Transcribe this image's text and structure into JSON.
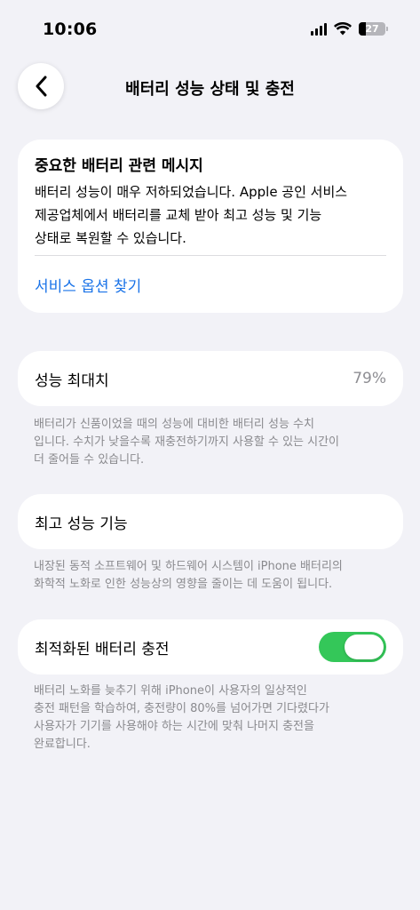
{
  "status_bar": {
    "time": "10:06",
    "battery_level": "27"
  },
  "nav": {
    "title": "배터리 성능 상태 및 충전"
  },
  "alert": {
    "title": "중요한 배터리 관련 메시지",
    "lines": [
      "배터리 성능이 매우 저하되었습니다. Apple 공인 서비스",
      "제공업체에서 배터리를 교체 받아 최고 성능 및 기능",
      "상태로 복원할 수 있습니다."
    ],
    "link": "서비스 옵션 찾기",
    "link_color": "#1a73e8"
  },
  "maximum_capacity": {
    "label": "성능 최대치",
    "value": "79%",
    "footnote_lines": [
      "배터리가 신품이었을 때의 성능에 대비한 배터리 성능 수치",
      "입니다. 수치가 낮을수록 재충전하기까지 사용할 수 있는 시간이",
      "더 줄어들 수 있습니다."
    ]
  },
  "peak_performance": {
    "label": "최고 성능 기능",
    "footnote_lines": [
      "내장된 동적 소프트웨어 및 하드웨어 시스템이 iPhone 배터리의",
      "화학적 노화로 인한 성능상의 영향을 줄이는 데 도움이 됩니다."
    ]
  },
  "optimized_charging": {
    "label": "최적화된 배터리 충전",
    "enabled": true,
    "toggle_color": "#34c759",
    "footnote_lines": [
      "배터리 노화를 늦추기 위해 iPhone이 사용자의 일상적인",
      "충전 패턴을 학습하여, 충전량이 80%를 넘어가면 기다렸다가",
      "사용자가 기기를 사용해야 하는 시간에 맞춰 나머지 충전을",
      "완료합니다."
    ]
  }
}
